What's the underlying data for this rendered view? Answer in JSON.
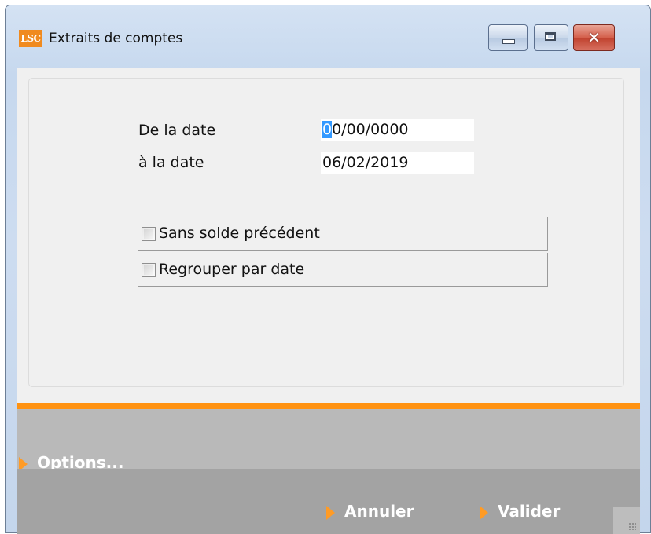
{
  "window": {
    "title": "Extraits de comptes",
    "logo_text": "LSC",
    "close_glyph": "✕"
  },
  "form": {
    "from_label": "De la date",
    "from_value_selected": "0",
    "from_value_rest": "0/00/0000",
    "to_label": "à la date",
    "to_value": "06/02/2019"
  },
  "options": [
    {
      "label": "Sans solde précédent",
      "checked": false
    },
    {
      "label": "Regrouper par date",
      "checked": false
    }
  ],
  "footer": {
    "options_label": "Options...",
    "cancel_label": "Annuler",
    "validate_label": "Valider"
  },
  "colors": {
    "accent": "#ff9211",
    "arrow": "#ff9b25",
    "options_band": "#b9b9b9",
    "action_band": "#a3a3a3"
  },
  "icons": {
    "minimize": "minimize-icon",
    "maximize": "maximize-icon",
    "close": "close-icon",
    "arrow": "triangle-right-icon",
    "resize": "resize-grip-icon"
  }
}
